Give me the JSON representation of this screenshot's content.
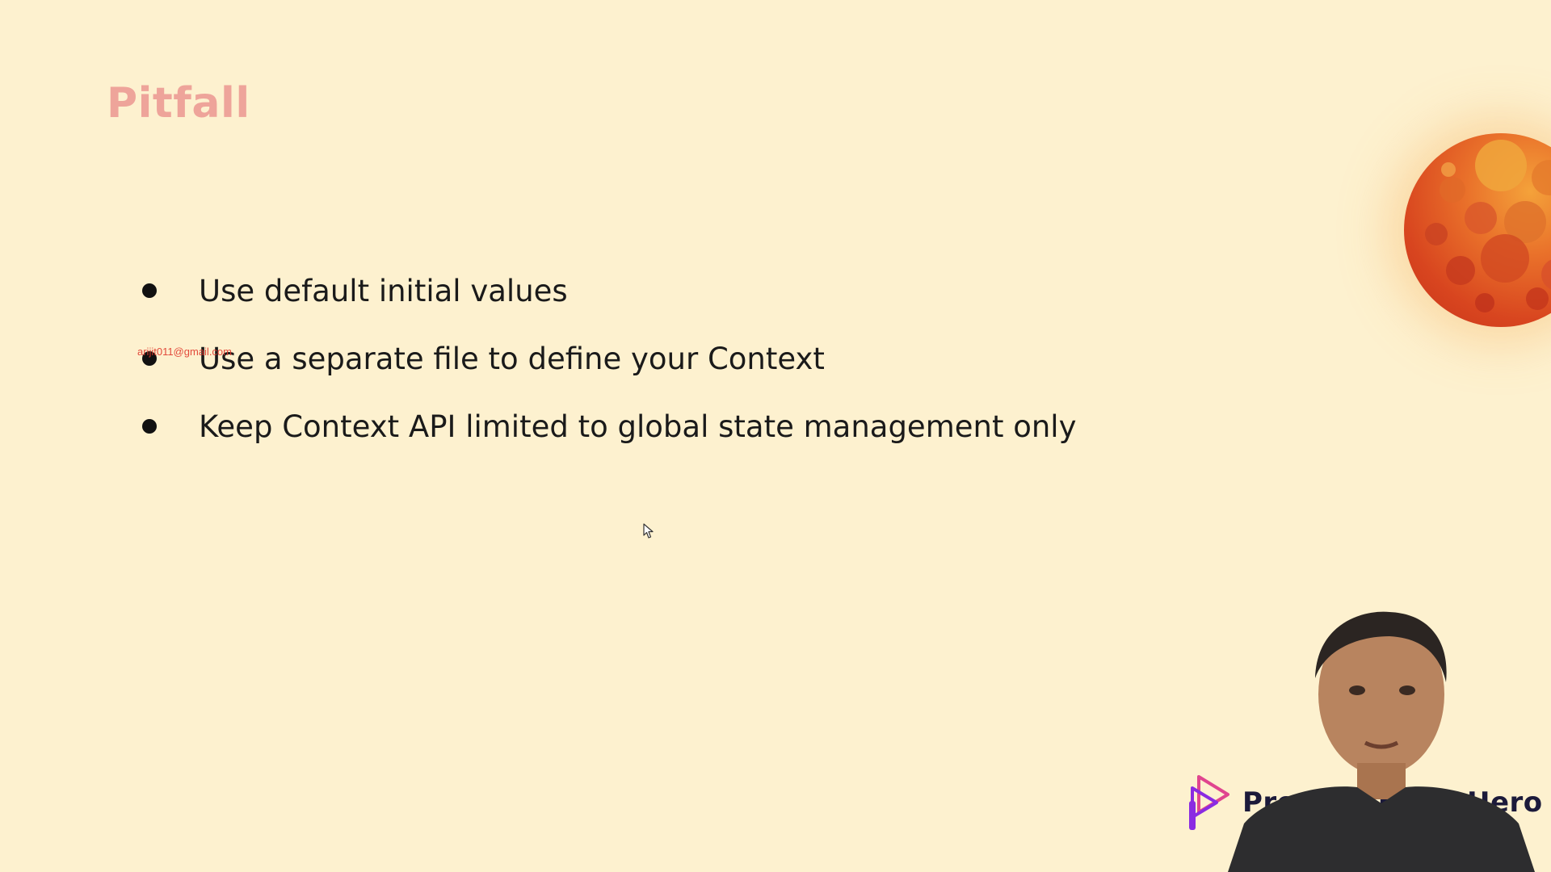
{
  "slide": {
    "title": "Pitfall",
    "bullets": [
      {
        "text": "Use default initial values"
      },
      {
        "text": "Use a separate file to define your Context"
      },
      {
        "text": "Keep Context API limited to global state management only"
      }
    ],
    "watermark_email": "arijit011@gmail.com"
  },
  "branding": {
    "logo_icon": "play-triangle-logo-icon",
    "logo_text": "Programming Hero"
  },
  "colors": {
    "background": "#fdf1cf",
    "title": "#eea49a",
    "body_text": "#1a1a1a",
    "watermark": "#e0392b",
    "logo_purple": "#8a2be2",
    "logo_pink": "#e0458f"
  },
  "icons": {
    "planet": "planet-icon",
    "cursor": "mouse-cursor-icon"
  }
}
